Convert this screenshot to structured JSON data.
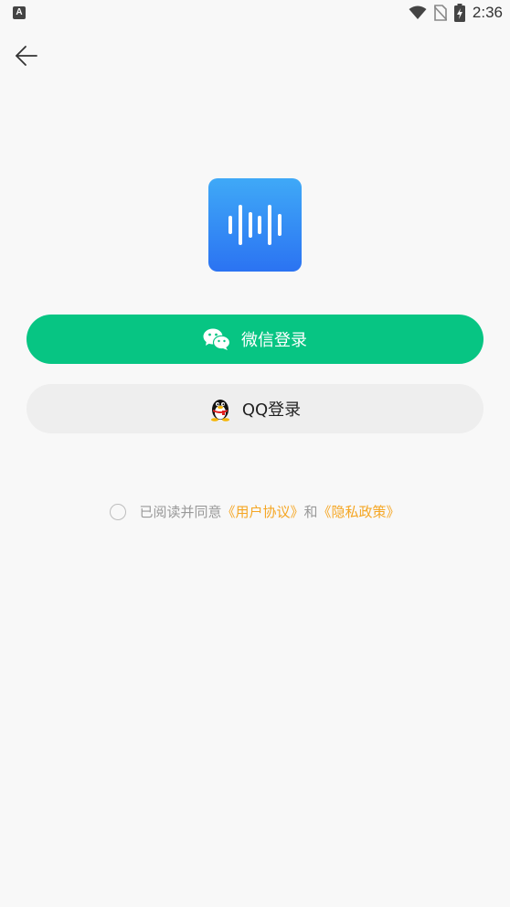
{
  "status_bar": {
    "left_icon": "A",
    "time": "2:36",
    "icons": [
      "wifi-icon",
      "no-sim-icon",
      "battery-charging-icon"
    ]
  },
  "nav": {
    "back_icon": "arrow-left-icon"
  },
  "logo": {
    "icon": "sound-wave-icon",
    "gradient_top": "#3fa9f7",
    "gradient_bottom": "#2b73f2"
  },
  "login": {
    "wechat_label": "微信登录",
    "wechat_icon": "wechat-icon",
    "wechat_color": "#07c583",
    "qq_label": "QQ登录",
    "qq_icon": "qq-penguin-icon",
    "qq_bg": "#eeeeee"
  },
  "agreement": {
    "checked": false,
    "prefix": "已阅读并同意",
    "user_agreement": "《用户协议》",
    "conjunction": "和",
    "privacy_policy": "《隐私政策》",
    "link_color": "#f5a623"
  }
}
